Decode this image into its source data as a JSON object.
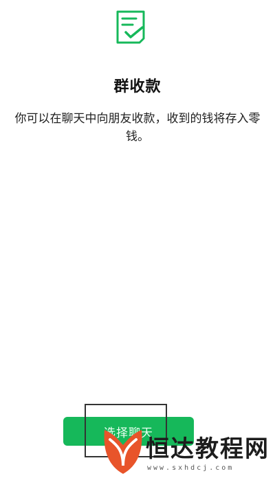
{
  "page": {
    "title": "群收款",
    "description": "你可以在聊天中向朋友收款，收到的钱将存入零钱。"
  },
  "actions": {
    "select_chat_label": "选择聊天"
  },
  "icon": {
    "name": "receipt-check-icon",
    "color": "#16b85a"
  },
  "watermark": {
    "name": "恒达教程网",
    "url": "www.sxhdcj.com",
    "logo_color": "#e8542a"
  }
}
